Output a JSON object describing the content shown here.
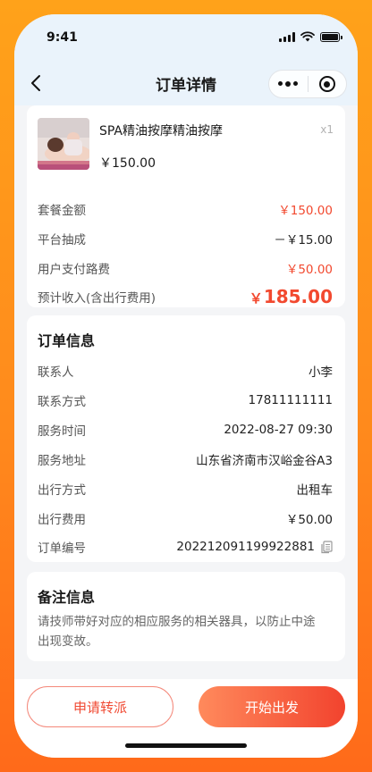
{
  "status_bar": {
    "time": "9:41"
  },
  "nav": {
    "title": "订单详情"
  },
  "product": {
    "name": "SPA精油按摩精油按摩",
    "qty": "x1",
    "price": "￥150.00"
  },
  "fees": [
    {
      "label": "套餐金额",
      "value": "￥150.00"
    },
    {
      "label": "平台抽成",
      "value": "－￥15.00"
    },
    {
      "label": "用户支付路费",
      "value": "￥50.00"
    }
  ],
  "income": {
    "label": "预计收入(含出行费用)",
    "currency": "￥",
    "amount": "185.00"
  },
  "order_info": {
    "title": "订单信息",
    "rows": [
      {
        "label": "联系人",
        "value": "小李"
      },
      {
        "label": "联系方式",
        "value": "17811111111"
      },
      {
        "label": "服务时间",
        "value": "2022-08-27 09:30"
      },
      {
        "label": "服务地址",
        "value": "山东省济南市汉峪金谷A3"
      },
      {
        "label": "出行方式",
        "value": "出租车"
      },
      {
        "label": "出行费用",
        "value": "￥50.00"
      },
      {
        "label": "订单编号",
        "value": "202212091199922881"
      }
    ]
  },
  "notes": {
    "title": "备注信息",
    "text": "请技师带好对应的相应服务的相关器具，以防止中途出现变故。"
  },
  "actions": {
    "transfer_label": "申请转派",
    "depart_label": "开始出发"
  },
  "colors": {
    "accent_red": "#f2492f",
    "page_bg": "#f4f5f7",
    "frame_orange": "#ff8a1c"
  }
}
